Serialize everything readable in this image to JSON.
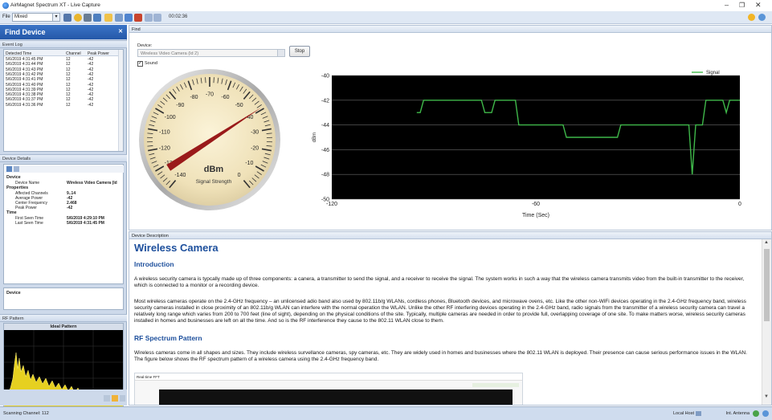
{
  "window": {
    "title": "AirMagnet Spectrum XT  -  Live Capture"
  },
  "toolbar": {
    "file_label": "File",
    "mode_value": "Mixed",
    "elapsed": "00:02:36"
  },
  "left": {
    "title": "Find Device",
    "event_log": {
      "header": "Event Log",
      "columns": [
        "Detected Time",
        "Channel",
        "Peak Power"
      ],
      "rows": [
        [
          "5/6/2019 4:31:45 PM",
          "12",
          "-42"
        ],
        [
          "5/6/2019 4:31:44 PM",
          "12",
          "-42"
        ],
        [
          "5/6/2019 4:31:43 PM",
          "12",
          "-42"
        ],
        [
          "5/6/2019 4:31:42 PM",
          "12",
          "-42"
        ],
        [
          "5/6/2019 4:31:41 PM",
          "12",
          "-42"
        ],
        [
          "5/6/2019 4:31:40 PM",
          "12",
          "-42"
        ],
        [
          "5/6/2019 4:31:39 PM",
          "12",
          "-42"
        ],
        [
          "5/6/2019 4:31:38 PM",
          "12",
          "-42"
        ],
        [
          "5/6/2019 4:31:37 PM",
          "12",
          "-42"
        ],
        [
          "5/6/2019 4:31:36 PM",
          "12",
          "-42"
        ]
      ]
    },
    "details": {
      "header": "Device Details",
      "device_cat": "Device",
      "device_name_k": "Device Name",
      "device_name_v": "Wireless Video Camera (Id",
      "properties_cat": "Properties",
      "affected_k": "Affected Channels",
      "affected_v": "9..14",
      "avg_k": "Average Power",
      "avg_v": "-42",
      "center_k": "Center Frequency",
      "center_v": "2.468",
      "peak_k": "Peak Power",
      "peak_v": "-42",
      "time_cat": "Time",
      "first_k": "First Seen Time",
      "first_v": "5/6/2019 4:29:10 PM",
      "last_k": "Last Seen Time",
      "last_v": "5/6/2019 4:31:45 PM"
    },
    "device_box": "Device",
    "rf_header": "RF Pattern",
    "rf_title": "Ideal Pattern"
  },
  "find": {
    "header": "Find",
    "device_label": "Device:",
    "device_value": "Wireless Video Camera (Id 2)",
    "stop_label": "Stop",
    "sound_label": "Sound",
    "sound_checked": "✓"
  },
  "gauge": {
    "unit": "dBm",
    "subtitle": "Signal Strength",
    "labels": [
      "-140",
      "-130",
      "-120",
      "-110",
      "-100",
      "-90",
      "-80",
      "-70",
      "-60",
      "-50",
      "-40",
      "-30",
      "-20",
      "-10",
      "0"
    ],
    "value": -41
  },
  "chart_data": {
    "type": "line",
    "title": "",
    "xlabel": "Time (Sec)",
    "ylabel": "dBm",
    "xlim": [
      -120,
      0
    ],
    "ylim": [
      -50,
      -40
    ],
    "x_ticks": [
      "-120",
      "-60",
      "0"
    ],
    "y_ticks": [
      "-40",
      "-42",
      "-44",
      "-46",
      "-48",
      "-50"
    ],
    "legend": "top-right",
    "grid": true,
    "series": [
      {
        "name": "Signal",
        "color": "#3fb84a",
        "x": [
          -95,
          -94,
          -93,
          -92,
          -90,
          -86,
          -85,
          -84,
          -83,
          -80,
          -77,
          -76,
          -75,
          -73,
          -72,
          -70,
          -67,
          -66,
          -65,
          -60,
          -56,
          -55,
          -54,
          -53,
          -52,
          -51,
          -50,
          -49,
          -48,
          -47,
          -45,
          -40,
          -37,
          -36,
          -35,
          -34,
          -30,
          -25,
          -20,
          -15,
          -14,
          -13,
          -12,
          -11,
          -10,
          -6,
          -5,
          -4,
          -3,
          -2,
          -1,
          0
        ],
        "y": [
          -43,
          -43,
          -42,
          -42,
          -42,
          -42,
          -42,
          -42,
          -42,
          -42,
          -42,
          -42,
          -43,
          -43,
          -42,
          -42,
          -42,
          -42,
          -44,
          -44,
          -44,
          -44,
          -44,
          -44,
          -44,
          -45,
          -45,
          -45,
          -45,
          -45,
          -45,
          -45,
          -45,
          -45,
          -44,
          -44,
          -44,
          -44,
          -44,
          -44,
          -48,
          -44,
          -44,
          -44,
          -42,
          -42,
          -42,
          -43,
          -42,
          -42,
          -42,
          -42
        ]
      }
    ]
  },
  "description": {
    "header": "Device Description",
    "title": "Wireless Camera",
    "intro_h": "Introduction",
    "p1": "A wireless security camera is typcally made up of three components: a canera, a transmitter to send the signal, and a receiver to receive the signal. The system works in such a way that the wireless camera transmits video from the built-in transmitter to the receiver, which is connected to a monitor or a recording device.",
    "p2": "Most wireless cameras operate on the 2.4-GHz frequency – an unlicensed adio band also used by 802.11b/g WLANs, cordless phones, Bluetooth devices, and microwave ovens, etc. Like the other non-WiFi devices operating in the 2.4-GHz frequency band, wireless security cameras installed in close proximity of an 802.11b/g WLAN can interfere with the normal operation the WLAN. Unlike the other RF interfering devices operating in the 2.4-GHz band, radio signals from the transmitter of a wireless security camera can travel a relatively long range which varies from 200 to 700 feet (line of sight), depending on the physical conditions of the site. Typically, multiple cameras are needed in order to provide full, overlapping coverage of one site. To make matters worse, wireless security cameras installed in homes and businesses are left on all the time. And so is the RF interference they cause to the 802.11 WLAN close to them.",
    "rf_h": "RF Spectrum Pattern",
    "p3": "Wireless cameras come in all shapes and sizes. They include wireless survellance cameras, spy cameras, etc. They are widely used in homes and businesses where the 802.11 WLAN is deployed. Their presence can cause serious performance issues in the WLAN. The figure below shows the RF spectrum pattern of a wireless camera using the 2.4-GHz frequency band.",
    "fig_title": "Real-time FFT"
  },
  "status": {
    "left": "Scanning Channel: 112",
    "right": "Local Host",
    "right2": "Int. Antenna"
  }
}
